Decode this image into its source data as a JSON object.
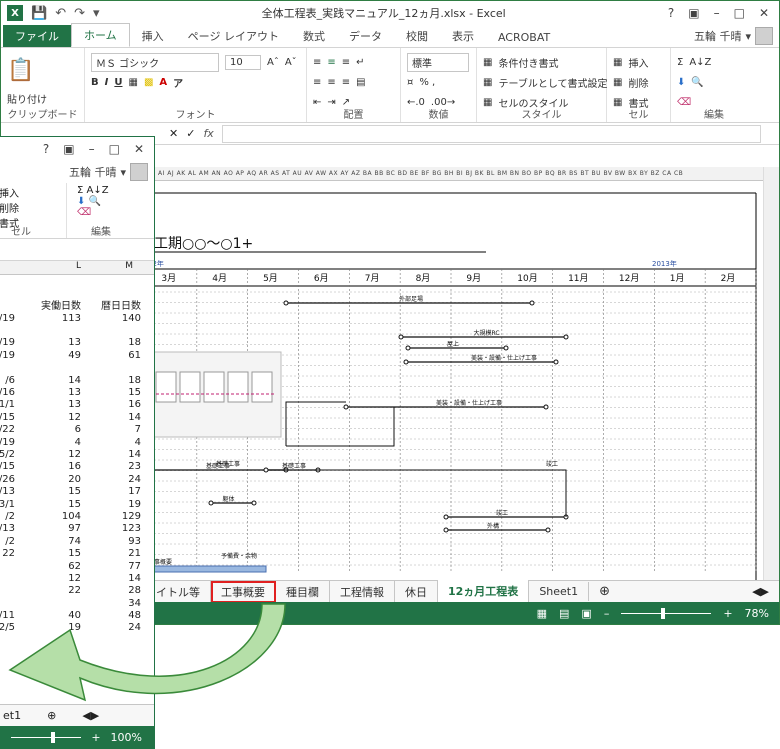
{
  "app": {
    "title": "全体工程表_実践マニュアル_12ヵ月.xlsx - Excel",
    "logo": "X",
    "help": "?",
    "user": "五輪 千晴"
  },
  "colors": {
    "accent": "#217346",
    "highlight": "#e02020",
    "arrow": "#a8d8a0"
  },
  "tabs": [
    {
      "label": "ファイル"
    },
    {
      "label": "ホーム"
    },
    {
      "label": "挿入"
    },
    {
      "label": "ページ レイアウト"
    },
    {
      "label": "数式"
    },
    {
      "label": "データ"
    },
    {
      "label": "校閲"
    },
    {
      "label": "表示"
    },
    {
      "label": "ACROBAT"
    }
  ],
  "ribbon": {
    "clipboard": {
      "paste": "貼り付け",
      "label": "クリップボード"
    },
    "font": {
      "name": "ＭＳ ゴシック",
      "size": "10",
      "bold": "B",
      "italic": "I",
      "underline": "U",
      "label": "フォント"
    },
    "align": {
      "label": "配置"
    },
    "number": {
      "format": "標準",
      "percent": "% ,",
      "label": "数値"
    },
    "style": {
      "cond": "条件付き書式",
      "table": "テーブルとして書式設定",
      "cell": "セルのスタイル",
      "label": "スタイル"
    },
    "cells": {
      "insert": "挿入",
      "delete": "削除",
      "format": "書式",
      "label": "セル"
    },
    "edit": {
      "label": "編集"
    }
  },
  "formula": {
    "fx": "fx"
  },
  "col_headers": "AH AI AJ AK AL AM AN AO AP AQ AR AS AT AU AV AW AX AY AZ BA BB BC BD BE BF BG BH BI BJ BK BL BM BN BO BP BQ BR BS BT BU BV BW BX BY BZ CA CB",
  "sheet": {
    "period": "工期○○～○1+",
    "year1": "12年",
    "year2": "2013年",
    "months": [
      "3月",
      "4月",
      "5月",
      "6月",
      "7月",
      "8月",
      "9月",
      "10月",
      "11月",
      "12月",
      "1月",
      "2月"
    ],
    "labels": [
      "外部足場",
      "大規模RC",
      "屋上",
      "屋上",
      "美装・設備・仕上げ工事",
      "美装・設備・仕上げ工事",
      "基礎工事",
      "躯体",
      "外構",
      "竣工",
      "工事概要",
      "予備費・余物",
      "手直し"
    ]
  },
  "sheet_tabs": [
    "イトル等",
    "工事概要",
    "種目欄",
    "工程情報",
    "休日",
    "12ヵ月工程表",
    "Sheet1"
  ],
  "status": {
    "zoom": "78%"
  },
  "back": {
    "user": "五輪 千晴",
    "cells": {
      "insert": "挿入",
      "delete": "削除",
      "format": "書式",
      "label": "セル"
    },
    "edit": {
      "label": "編集"
    },
    "headers": {
      "col_l": "L",
      "col_m": "M",
      "work_days": "実働日数",
      "cal_days": "暦日日数"
    },
    "rows": [
      [
        "/19",
        "113",
        "140"
      ],
      [
        "",
        "",
        " "
      ],
      [
        "/19",
        "13",
        "18"
      ],
      [
        "/19",
        "49",
        "61"
      ],
      [
        "",
        "",
        " "
      ],
      [
        "/6",
        "14",
        "18"
      ],
      [
        "/16",
        "13",
        "15"
      ],
      [
        "1/1",
        "13",
        "16"
      ],
      [
        "/15",
        "12",
        "14"
      ],
      [
        "/22",
        "6",
        "7"
      ],
      [
        "/19",
        "4",
        "4"
      ],
      [
        "5/2",
        "12",
        "14"
      ],
      [
        "/15",
        "16",
        "23"
      ],
      [
        "/26",
        "20",
        "24"
      ],
      [
        "/13",
        "15",
        "17"
      ],
      [
        "3/1",
        "15",
        "19"
      ],
      [
        "/2",
        "104",
        "129"
      ],
      [
        "/13",
        "97",
        "123"
      ],
      [
        "/2",
        "74",
        "93"
      ],
      [
        "22",
        "15",
        "21"
      ],
      [
        "",
        "62",
        "77"
      ],
      [
        "",
        "12",
        "14"
      ],
      [
        "",
        "22",
        "28"
      ],
      [
        "",
        "",
        "34"
      ],
      [
        "/11",
        "40",
        "48"
      ],
      [
        "2/5",
        "19",
        "24"
      ]
    ],
    "sheettab": "et1",
    "zoom": "100%"
  }
}
